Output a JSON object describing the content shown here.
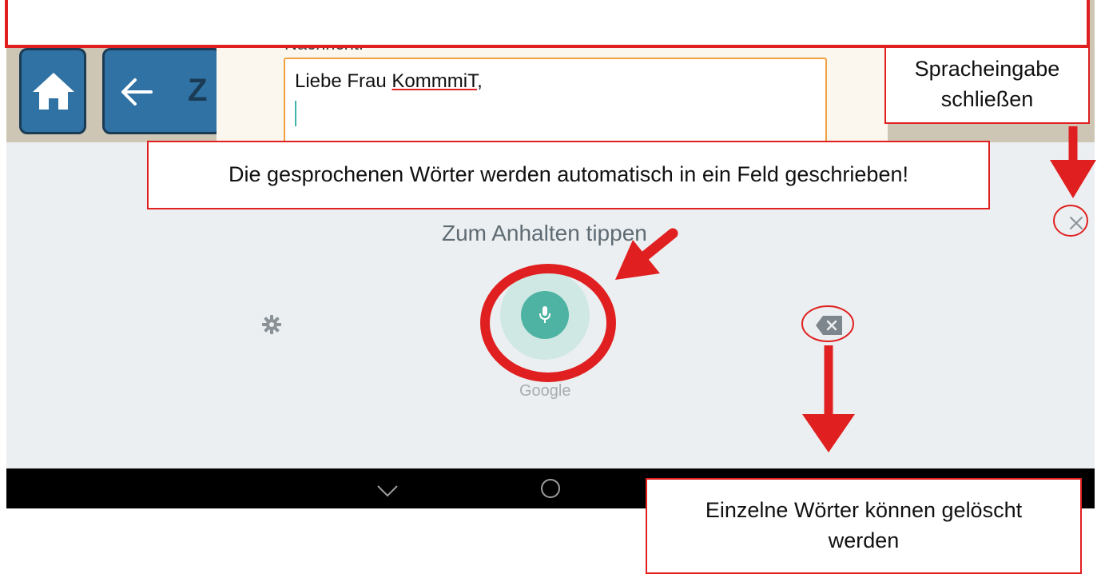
{
  "app": {
    "tile_text": "Z",
    "message_label": "Nachricht:",
    "message_value": "Liebe Frau ",
    "message_value_underlined": "KommmiT",
    "message_value_suffix": ","
  },
  "voice_input": {
    "hint": "Zum Anhalten tippen",
    "brand": "Google",
    "accent_color": "#4eb3a2"
  },
  "annotations": {
    "close_voice_input": [
      "Spracheingabe",
      "schließen"
    ],
    "spoken_words": "Die gesprochenen Wörter werden automatisch in ein Feld geschrieben!",
    "delete_words": [
      "Einzelne Wörter können gelöscht",
      "werden"
    ],
    "highlight_color": "#e02020"
  },
  "icons": [
    "home-icon",
    "back-arrow-icon",
    "microphone-icon",
    "settings-icon",
    "backspace-icon",
    "close-icon",
    "nav-back-icon",
    "nav-home-icon"
  ]
}
